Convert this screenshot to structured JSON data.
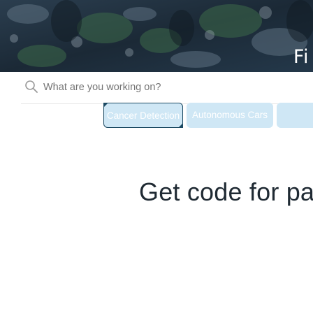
{
  "hero": {
    "title": "Fi"
  },
  "search": {
    "placeholder": "What are you working on?",
    "value": ""
  },
  "chips": [
    {
      "label": "Cancer Detection",
      "selected": true
    },
    {
      "label": "Autonomous Cars",
      "selected": false
    },
    {
      "label": "",
      "selected": false
    }
  ],
  "headline": "Get code for paper",
  "icons": {
    "search": "search-icon"
  },
  "colors": {
    "hero_bg": "#1e2c3a",
    "chip_bg": "#cfe7f5",
    "chip_text": "#ffffff",
    "headline_text": "#1f2a33",
    "focus_border": "#1c4a63"
  }
}
